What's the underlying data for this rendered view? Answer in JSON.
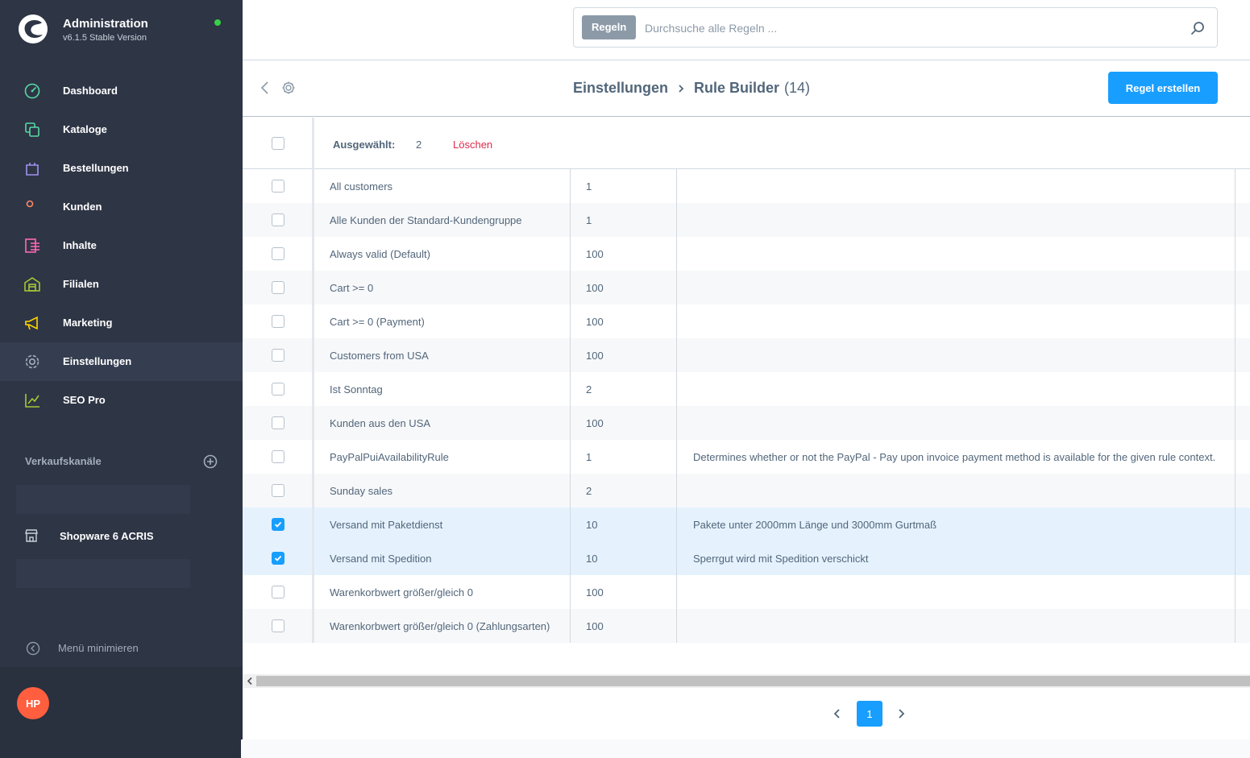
{
  "app": {
    "title": "Administration",
    "version": "v6.1.5 Stable Version"
  },
  "sidebar": {
    "items": [
      {
        "label": "Dashboard",
        "icon": "dashboard-icon",
        "color": "#57d9a3"
      },
      {
        "label": "Kataloge",
        "icon": "catalog-icon",
        "color": "#57d9a3"
      },
      {
        "label": "Bestellungen",
        "icon": "shopping-bag-icon",
        "color": "#a092f0"
      },
      {
        "label": "Kunden",
        "icon": "users-icon",
        "color": "#f88962"
      },
      {
        "label": "Inhalte",
        "icon": "content-icon",
        "color": "#ff68b4"
      },
      {
        "label": "Filialen",
        "icon": "store-icon",
        "color": "#a6c836"
      },
      {
        "label": "Marketing",
        "icon": "megaphone-icon",
        "color": "#ffd700"
      },
      {
        "label": "Einstellungen",
        "icon": "gear-icon",
        "color": "#a2adba"
      },
      {
        "label": "SEO Pro",
        "icon": "chart-trend-icon",
        "color": "#a6c836"
      }
    ],
    "active_index": 7,
    "channels_title": "Verkaufskanäle",
    "channel": {
      "label": "Shopware 6 ACRIS",
      "icon": "storefront-icon"
    },
    "minimize_label": "Menü minimieren",
    "user_initials": "HP"
  },
  "search": {
    "tag": "Regeln",
    "placeholder": "Durchsuche alle Regeln ..."
  },
  "smartbar": {
    "breadcrumb_parent": "Einstellungen",
    "breadcrumb_current": "Rule Builder",
    "count": "(14)",
    "create_button": "Regel erstellen"
  },
  "bulk": {
    "label": "Ausgewählt:",
    "count": "2",
    "delete_label": "Löschen"
  },
  "rules": [
    {
      "name": "All customers",
      "priority": "1",
      "description": "",
      "selected": false
    },
    {
      "name": "Alle Kunden der Standard-Kundengruppe",
      "priority": "1",
      "description": "",
      "selected": false
    },
    {
      "name": "Always valid (Default)",
      "priority": "100",
      "description": "",
      "selected": false
    },
    {
      "name": "Cart >= 0",
      "priority": "100",
      "description": "",
      "selected": false
    },
    {
      "name": "Cart >= 0 (Payment)",
      "priority": "100",
      "description": "",
      "selected": false
    },
    {
      "name": "Customers from USA",
      "priority": "100",
      "description": "",
      "selected": false
    },
    {
      "name": "Ist Sonntag",
      "priority": "2",
      "description": "",
      "selected": false
    },
    {
      "name": "Kunden aus den USA",
      "priority": "100",
      "description": "",
      "selected": false
    },
    {
      "name": "PayPalPuiAvailabilityRule",
      "priority": "1",
      "description": "Determines whether or not the PayPal - Pay upon invoice payment method is available for the given rule context.",
      "selected": false
    },
    {
      "name": "Sunday sales",
      "priority": "2",
      "description": "",
      "selected": false
    },
    {
      "name": "Versand mit Paketdienst",
      "priority": "10",
      "description": "Pakete unter 2000mm Länge und 3000mm Gurtmaß",
      "selected": true
    },
    {
      "name": "Versand mit Spedition",
      "priority": "10",
      "description": "Sperrgut wird mit Spedition verschickt",
      "selected": true
    },
    {
      "name": "Warenkorbwert größer/gleich 0",
      "priority": "100",
      "description": "",
      "selected": false
    },
    {
      "name": "Warenkorbwert größer/gleich 0 (Zahlungsarten)",
      "priority": "100",
      "description": "",
      "selected": false
    }
  ],
  "pagination": {
    "current_page": "1"
  }
}
